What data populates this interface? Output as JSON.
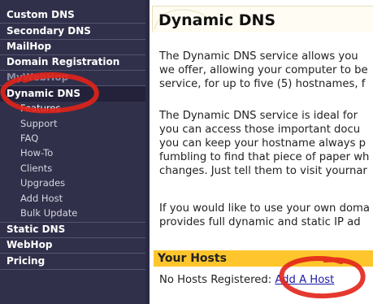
{
  "sidebar": {
    "top_items": [
      {
        "label": "Custom DNS"
      },
      {
        "label": "Secondary DNS"
      },
      {
        "label": "MailHop"
      },
      {
        "label": "Domain Registration"
      },
      {
        "label": "MyWebHop"
      },
      {
        "label": "Dynamic DNS"
      }
    ],
    "sub_items": [
      {
        "label": "Features"
      },
      {
        "label": "Support"
      },
      {
        "label": "FAQ"
      },
      {
        "label": "How-To"
      },
      {
        "label": "Clients"
      },
      {
        "label": "Upgrades"
      },
      {
        "label": "Add Host"
      },
      {
        "label": "Bulk Update"
      }
    ],
    "bottom_items": [
      {
        "label": "Static DNS"
      },
      {
        "label": "WebHop"
      },
      {
        "label": "Pricing"
      }
    ]
  },
  "main": {
    "title": "Dynamic DNS",
    "para1": [
      "The Dynamic DNS service allows you",
      "we offer, allowing your computer to be",
      "service, for up to five (5) hostnames, f"
    ],
    "para2": [
      "The Dynamic DNS service is ideal for",
      "you can access those important docu",
      "you can keep your hostname always p",
      "fumbling to find that piece of paper wh",
      "changes. Just tell them to visit yournar"
    ],
    "para3": [
      "If you would like to use your own doma",
      "provides full dynamic and static IP ad"
    ],
    "hosts": {
      "title": "Your Hosts",
      "status": "No Hosts Registered:",
      "add_link": "Add A Host"
    }
  },
  "colors": {
    "sidebar_bg": "#31304a",
    "hosts_header": "#fec62c",
    "link": "#1a1aa6",
    "annotation": "#e2231a"
  }
}
